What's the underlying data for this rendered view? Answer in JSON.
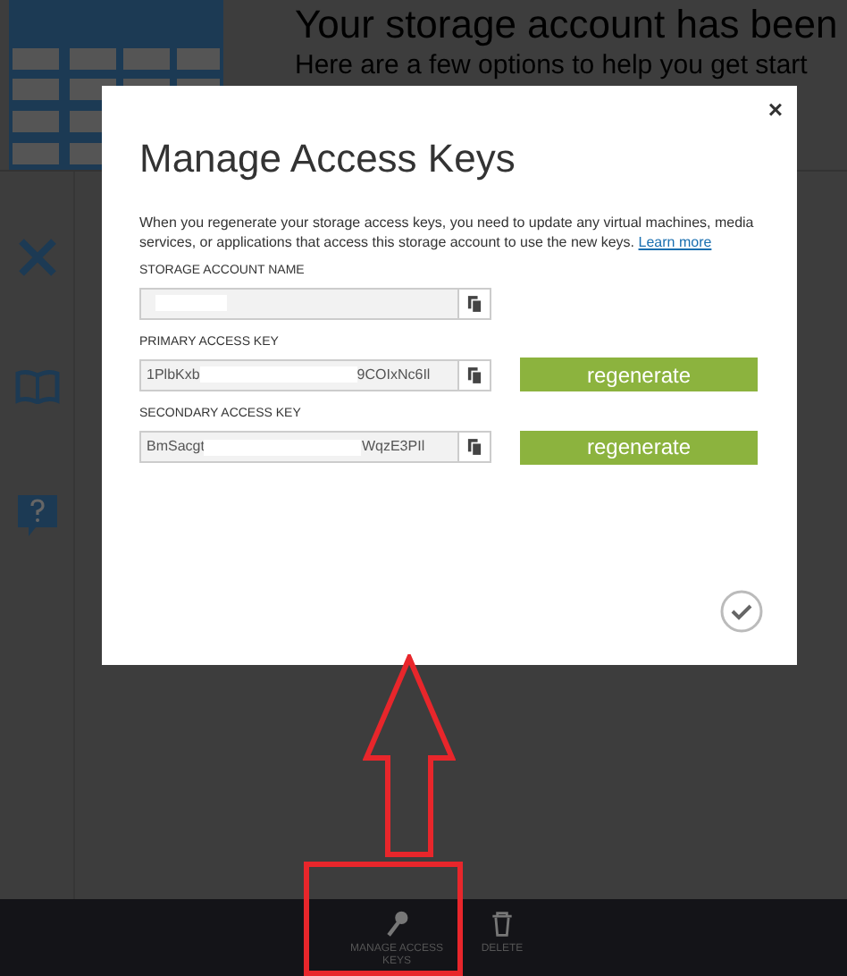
{
  "page": {
    "title": "Your storage account has been",
    "subtitle": "Here are a few options to help you get start"
  },
  "dialog": {
    "title": "Manage Access Keys",
    "close": "×",
    "description": "When you regenerate your storage access keys, you need to update any virtual machines, media services, or applications that access this storage account to use the new keys.",
    "link": "Learn more",
    "fields": [
      {
        "label": "STORAGE ACCOUNT NAME",
        "redacted": true
      },
      {
        "label": "PRIMARY ACCESS KEY",
        "value_start": "1PlbKxb",
        "value_end": "9COIxNc6Il",
        "redacted": true,
        "regenerate": "regenerate"
      },
      {
        "label": "SECONDARY ACCESS KEY",
        "value_start": "BmSacgt",
        "value_end": "WqzE3PIl",
        "redacted": true,
        "regenerate": "regenerate"
      }
    ]
  },
  "command_bar": [
    {
      "label": "MANAGE ACCESS KEYS",
      "kind": "key"
    },
    {
      "label": "DELETE",
      "kind": "trash"
    }
  ]
}
